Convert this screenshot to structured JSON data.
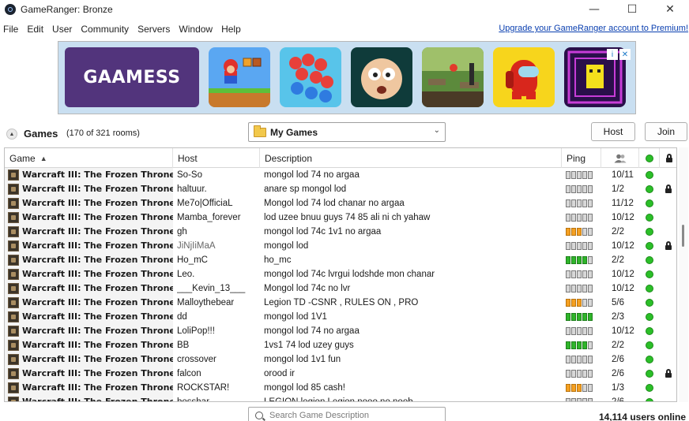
{
  "window": {
    "title": "GameRanger: Bronze",
    "controls": [
      "—",
      "☐",
      "✕"
    ]
  },
  "menu": {
    "items": [
      "File",
      "Edit",
      "User",
      "Community",
      "Servers",
      "Window",
      "Help"
    ],
    "premium_link": "Upgrade your GameRanger account to Premium!"
  },
  "ad": {
    "brand": "GAAMESS",
    "tiles": [
      "platformer-game",
      "crowd-runner-game",
      "cartoon-face-game",
      "jungle-runner-game",
      "impostor-game",
      "maze-game"
    ],
    "controls": [
      "i",
      "✕"
    ]
  },
  "games_bar": {
    "label": "Games",
    "rooms": "(170 of 321 rooms)",
    "filter": "My Games",
    "host_button": "Host",
    "join_button": "Join"
  },
  "table": {
    "columns": {
      "game": "Game",
      "host": "Host",
      "description": "Description",
      "ping": "Ping"
    },
    "rows": [
      {
        "game": "Warcraft III: The Frozen Throne",
        "host": "So-So",
        "desc": "mongol lod 74 no argaa",
        "ping": "0",
        "players": "10/11",
        "lock": false
      },
      {
        "game": "Warcraft III: The Frozen Throne",
        "host": "haltuur.",
        "desc": "anare  sp mongol lod",
        "ping": "0",
        "players": "1/2",
        "lock": true
      },
      {
        "game": "Warcraft III: The Frozen Throne",
        "host": "Me7o|OfficiaL",
        "desc": " Mongol lod 74 lod chanar no argaa",
        "ping": "0",
        "players": "11/12",
        "lock": false
      },
      {
        "game": "Warcraft III: The Frozen Throne",
        "host": "Mamba_forever",
        "desc": "lod uzee bnuu guys 74 85 ali ni ch yahaw",
        "ping": "0",
        "players": "10/12",
        "lock": false
      },
      {
        "game": "Warcraft III: The Frozen Throne",
        "host": "gh",
        "desc": "mongol lod 74c 1v1 no argaa",
        "ping": "o3",
        "players": "2/2",
        "lock": false
      },
      {
        "game": "Warcraft III: The Frozen Throne",
        "host": "JiNjIiMaA",
        "desc": "mongol lod",
        "ping": "0",
        "players": "10/12",
        "lock": true
      },
      {
        "game": "Warcraft III: The Frozen Throne",
        "host": "Ho_mC",
        "desc": "ho_mc",
        "ping": "g4",
        "players": "2/2",
        "lock": false
      },
      {
        "game": "Warcraft III: The Frozen Throne",
        "host": "Leo.",
        "desc": "mongol lod 74c lvrgui lodshde mon chanar",
        "ping": "0",
        "players": "10/12",
        "lock": false
      },
      {
        "game": "Warcraft III: The Frozen Throne",
        "host": "___Kevin_13___",
        "desc": "Mongol lod 74c  no lvr",
        "ping": "0",
        "players": "10/12",
        "lock": false
      },
      {
        "game": "Warcraft III: The Frozen Throne",
        "host": "Malloythebear",
        "desc": "Legion TD -CSNR , RULES ON , PRO",
        "ping": "o3",
        "players": "5/6",
        "lock": false
      },
      {
        "game": "Warcraft III: The Frozen Throne",
        "host": "dd",
        "desc": "mongol lod 1V1",
        "ping": "g5",
        "players": "2/3",
        "lock": false
      },
      {
        "game": "Warcraft III: The Frozen Throne",
        "host": "LoliPop!!!",
        "desc": "mongol lod 74 no argaa",
        "ping": "0",
        "players": "10/12",
        "lock": false
      },
      {
        "game": "Warcraft III: The Frozen Throne",
        "host": "BB",
        "desc": "1vs1 74 lod uzey guys",
        "ping": "g4",
        "players": "2/2",
        "lock": false
      },
      {
        "game": "Warcraft III: The Frozen Throne",
        "host": "crossover",
        "desc": "mongol lod 1v1 fun",
        "ping": "0",
        "players": "2/6",
        "lock": false
      },
      {
        "game": "Warcraft III: The Frozen Throne",
        "host": "falcon",
        "desc": "orood ir",
        "ping": "0",
        "players": "2/6",
        "lock": true
      },
      {
        "game": "Warcraft III: The Frozen Throne",
        "host": "ROCKSTAR!",
        "desc": "mongol lod 85 cash!",
        "ping": "o3",
        "players": "1/3",
        "lock": false
      },
      {
        "game": "Warcraft III: The Frozen Throne",
        "host": "bosshar",
        "desc": "LEGION legion Legion nooo no noob",
        "ping": "0",
        "players": "2/6",
        "lock": false
      }
    ]
  },
  "search": {
    "placeholder": "Search Game Description"
  },
  "status": {
    "users_online": "14,114 users online"
  },
  "colors": {
    "status_green": "#2bbf28",
    "ping_green": "#2fb52a",
    "ping_orange": "#f5a021",
    "link": "#0a3fb0"
  }
}
